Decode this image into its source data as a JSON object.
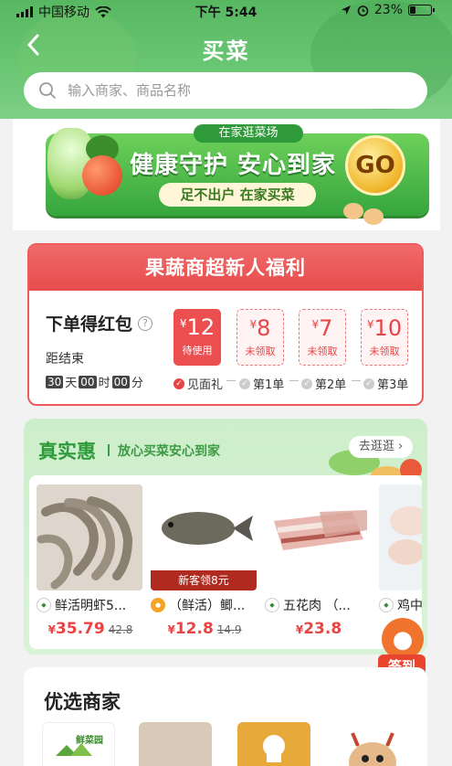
{
  "status_bar": {
    "carrier": "中国移动",
    "time": "下午 5:44",
    "battery": "23%",
    "battery_level": 0.23
  },
  "header": {
    "title": "买菜",
    "back_icon": "chevron-left-icon"
  },
  "search": {
    "placeholder": "输入商家、商品名称",
    "icon": "search-icon"
  },
  "banner": {
    "tag": "在家逛菜场",
    "headline": "健康守护 安心到家",
    "subline": "足不出户 在家买菜",
    "go": "GO"
  },
  "newcomer": {
    "title": "果蔬商超新人福利",
    "order_bonus": "下单得红包",
    "ends_label": "距结束",
    "timer": {
      "days": "30",
      "day_unit": "天",
      "hours": "00",
      "hour_unit": "时",
      "minutes": "00",
      "minute_unit": "分"
    },
    "coupons": [
      {
        "currency": "¥",
        "amount": "12",
        "status": "待使用"
      },
      {
        "currency": "¥",
        "amount": "8",
        "status": "未领取"
      },
      {
        "currency": "¥",
        "amount": "7",
        "status": "未领取"
      },
      {
        "currency": "¥",
        "amount": "10",
        "status": "未领取"
      }
    ],
    "steps": [
      "见面礼",
      "第1单",
      "第2单",
      "第3单"
    ]
  },
  "deals": {
    "title": "真实惠",
    "subtitle": "放心买菜安心到家",
    "more": "去逛逛",
    "products": [
      {
        "name": "鲜活明虾5...",
        "price": "35.79",
        "original": "42.8",
        "currency": "¥"
      },
      {
        "name": "（鲜活）鲫...",
        "price": "12.8",
        "original": "14.9",
        "currency": "¥",
        "ribbon": "新客领8元"
      },
      {
        "name": "五花肉 （...",
        "price": "23.8",
        "original": "",
        "currency": "¥"
      },
      {
        "name": "鸡中",
        "price": "",
        "original": "",
        "currency": "¥"
      }
    ]
  },
  "checkin": {
    "label": "签到"
  },
  "merchants": {
    "title": "优选商家",
    "first_logo_text": "鲜菜园"
  },
  "colors": {
    "brand_green": "#58b862",
    "red": "#e94444"
  }
}
